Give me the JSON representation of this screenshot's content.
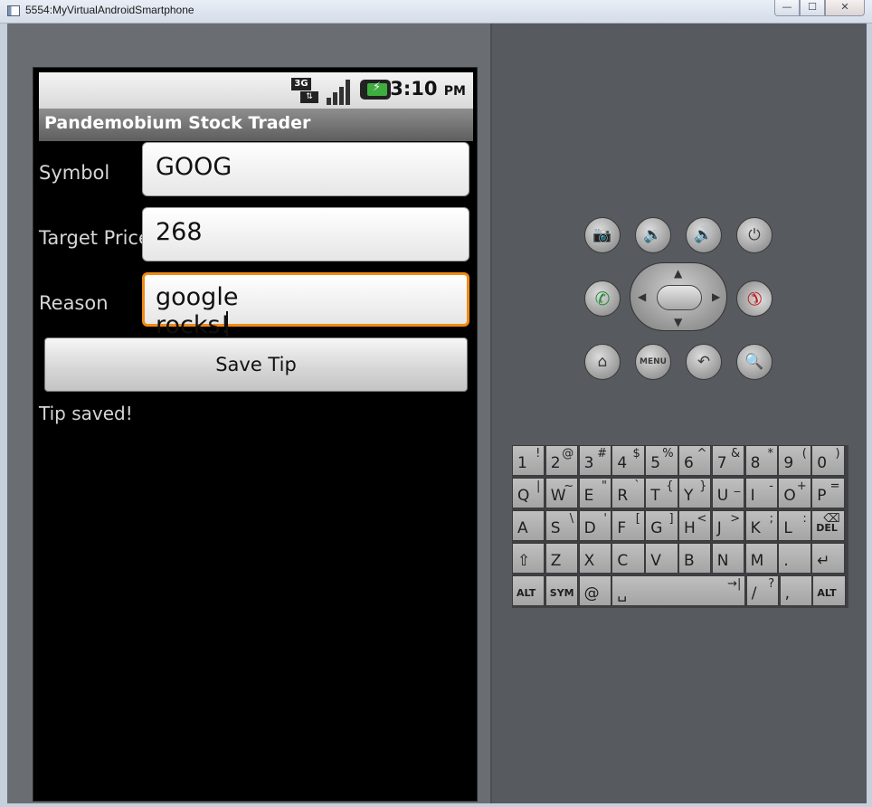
{
  "window": {
    "title": "5554:MyVirtualAndroidSmartphone",
    "minimize": "—",
    "maximize": "☐",
    "close": "✕"
  },
  "statusbar": {
    "network": "3G",
    "network_arrows": "⇅",
    "time": "3:10",
    "ampm": "PM"
  },
  "app": {
    "title": "Pandemobium Stock Trader",
    "fields": [
      {
        "label": "Symbol",
        "value": "GOOG"
      },
      {
        "label": "Target Price",
        "value": "268"
      },
      {
        "label": "Reason",
        "value": "google rocks!"
      }
    ],
    "save_button": "Save Tip",
    "status": "Tip saved!"
  },
  "controls": {
    "camera": "📷",
    "vol_down": "🔉",
    "vol_up": "🔊",
    "power": "⏻",
    "call": "✆",
    "end_call": "✆",
    "home": "⌂",
    "menu": "MENU",
    "back": "↶",
    "search": "🔍"
  },
  "keyboard": {
    "rows": [
      [
        {
          "m": "1",
          "s": "!"
        },
        {
          "m": "2",
          "s": "@"
        },
        {
          "m": "3",
          "s": "#"
        },
        {
          "m": "4",
          "s": "$"
        },
        {
          "m": "5",
          "s": "%"
        },
        {
          "m": "6",
          "s": "^"
        },
        {
          "m": "7",
          "s": "&"
        },
        {
          "m": "8",
          "s": "*"
        },
        {
          "m": "9",
          "s": "("
        },
        {
          "m": "0",
          "s": ")"
        }
      ],
      [
        {
          "m": "Q",
          "s": "|"
        },
        {
          "m": "W",
          "s": "~"
        },
        {
          "m": "E",
          "s": "\""
        },
        {
          "m": "R",
          "s": "`"
        },
        {
          "m": "T",
          "s": "{"
        },
        {
          "m": "Y",
          "s": "}"
        },
        {
          "m": "U",
          "s": "_"
        },
        {
          "m": "I",
          "s": "-"
        },
        {
          "m": "O",
          "s": "+"
        },
        {
          "m": "P",
          "s": "="
        }
      ],
      [
        {
          "m": "A",
          "s": ""
        },
        {
          "m": "S",
          "s": "\\"
        },
        {
          "m": "D",
          "s": "'"
        },
        {
          "m": "F",
          "s": "["
        },
        {
          "m": "G",
          "s": "]"
        },
        {
          "m": "H",
          "s": "<"
        },
        {
          "m": "J",
          "s": ">"
        },
        {
          "m": "K",
          "s": ";"
        },
        {
          "m": "L",
          "s": ":"
        },
        {
          "m": "DEL",
          "s": "⌫"
        }
      ],
      [
        {
          "m": "⇧",
          "s": ""
        },
        {
          "m": "Z",
          "s": ""
        },
        {
          "m": "X",
          "s": ""
        },
        {
          "m": "C",
          "s": ""
        },
        {
          "m": "V",
          "s": ""
        },
        {
          "m": "B",
          "s": ""
        },
        {
          "m": "N",
          "s": ""
        },
        {
          "m": "M",
          "s": ""
        },
        {
          "m": ".",
          "s": ""
        },
        {
          "m": "↵",
          "s": ""
        }
      ],
      [
        {
          "m": "ALT",
          "s": ""
        },
        {
          "m": "SYM",
          "s": ""
        },
        {
          "m": "@",
          "s": ""
        },
        {
          "m": "␣",
          "s": "→|"
        },
        {
          "m": "/",
          "s": "?"
        },
        {
          "m": ",",
          "s": ""
        },
        {
          "m": "ALT",
          "s": ""
        }
      ]
    ]
  }
}
